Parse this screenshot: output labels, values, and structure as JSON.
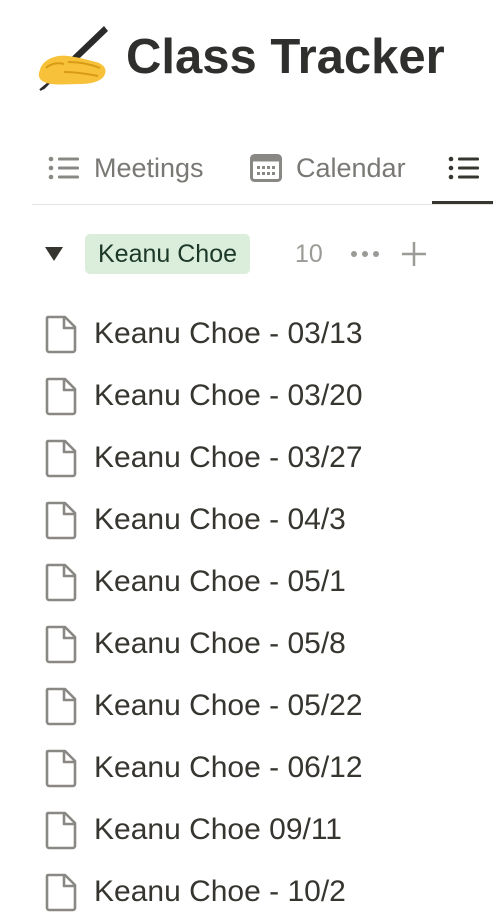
{
  "page": {
    "title": "Class Tracker",
    "title_icon": "writing-hand-emoji"
  },
  "tabs": [
    {
      "label": "Meetings",
      "icon": "list-icon",
      "active": false
    },
    {
      "label": "Calendar",
      "icon": "calendar-icon",
      "active": false
    },
    {
      "label": "",
      "icon": "list-icon",
      "active": true
    }
  ],
  "group": {
    "label": "Keanu Choe",
    "count": "10",
    "tag_color": "#dbeddb",
    "collapsed": false
  },
  "items": [
    {
      "title": "Keanu Choe - 03/13",
      "icon": "page-icon"
    },
    {
      "title": "Keanu Choe - 03/20",
      "icon": "page-icon"
    },
    {
      "title": "Keanu Choe - 03/27",
      "icon": "page-icon"
    },
    {
      "title": "Keanu Choe - 04/3",
      "icon": "page-icon"
    },
    {
      "title": "Keanu Choe - 05/1",
      "icon": "page-icon"
    },
    {
      "title": "Keanu Choe - 05/8",
      "icon": "page-icon"
    },
    {
      "title": "Keanu Choe - 05/22",
      "icon": "page-icon"
    },
    {
      "title": "Keanu Choe - 06/12",
      "icon": "page-icon"
    },
    {
      "title": "Keanu Choe 09/11",
      "icon": "page-icon"
    },
    {
      "title": "Keanu Choe - 10/2",
      "icon": "page-icon"
    }
  ]
}
